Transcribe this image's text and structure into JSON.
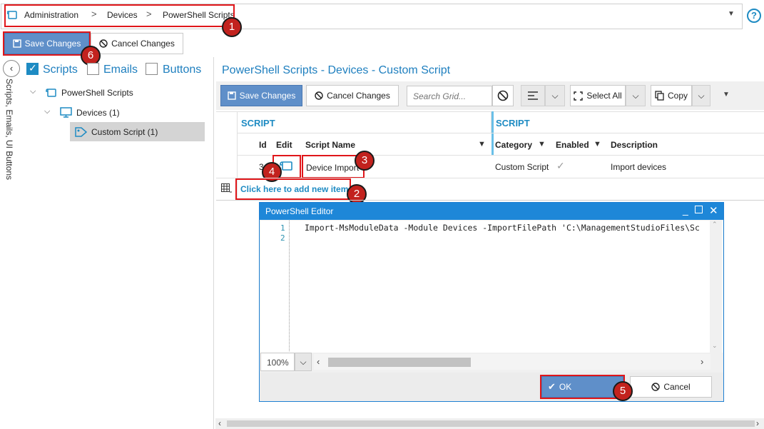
{
  "breadcrumb": {
    "items": [
      "Administration",
      "Devices",
      "PowerShell Scripts"
    ],
    "separator": ">",
    "dropdown_icon": "caret-down-icon",
    "help_icon": "question-circle-icon"
  },
  "top_actions": {
    "save_label": "Save Changes",
    "cancel_label": "Cancel Changes"
  },
  "markers": [
    "1",
    "2",
    "3",
    "4",
    "5",
    "6"
  ],
  "left_panel": {
    "vertical_tab_label": "Scripts, Emails, UI Buttons",
    "filters": [
      {
        "label": "Scripts",
        "checked": true
      },
      {
        "label": "Emails",
        "checked": false
      },
      {
        "label": "Buttons",
        "checked": false
      }
    ],
    "tree": [
      {
        "label": "PowerShell Scripts",
        "icon": "script-icon"
      },
      {
        "label": "Devices (1)",
        "icon": "monitor-icon"
      },
      {
        "label": "Custom Script (1)",
        "icon": "tag-icon",
        "selected": true
      }
    ]
  },
  "pane": {
    "title": "PowerShell Scripts - Devices - Custom Script"
  },
  "grid_toolbar": {
    "save_label": "Save Changes",
    "cancel_label": "Cancel Changes",
    "search_placeholder": "Search Grid...",
    "select_all_label": "Select All",
    "copy_label": "Copy"
  },
  "grid": {
    "bands": [
      "SCRIPT",
      "SCRIPT"
    ],
    "columns": [
      "Id",
      "Edit",
      "Script Name",
      "Category",
      "Enabled",
      "Description"
    ],
    "rows": [
      {
        "id": "3",
        "script_name": "Device Import",
        "category": "Custom Script",
        "enabled": true,
        "description": "Import devices"
      }
    ],
    "add_item_label": "Click here to add new item"
  },
  "editor": {
    "title": "PowerShell Editor",
    "line_numbers": [
      "1",
      "2"
    ],
    "code_line_1": "Import-MsModuleData -Module Devices -ImportFilePath 'C:\\ManagementStudioFiles\\Sc",
    "zoom": "100%",
    "ok_label": "OK",
    "cancel_label": "Cancel"
  },
  "colors": {
    "accent": "#1e8bc3",
    "button_blue": "#5f8fc9",
    "dialog_title": "#1e87d8",
    "marker_red": "#c2221e",
    "highlight_red": "#e0161a"
  }
}
